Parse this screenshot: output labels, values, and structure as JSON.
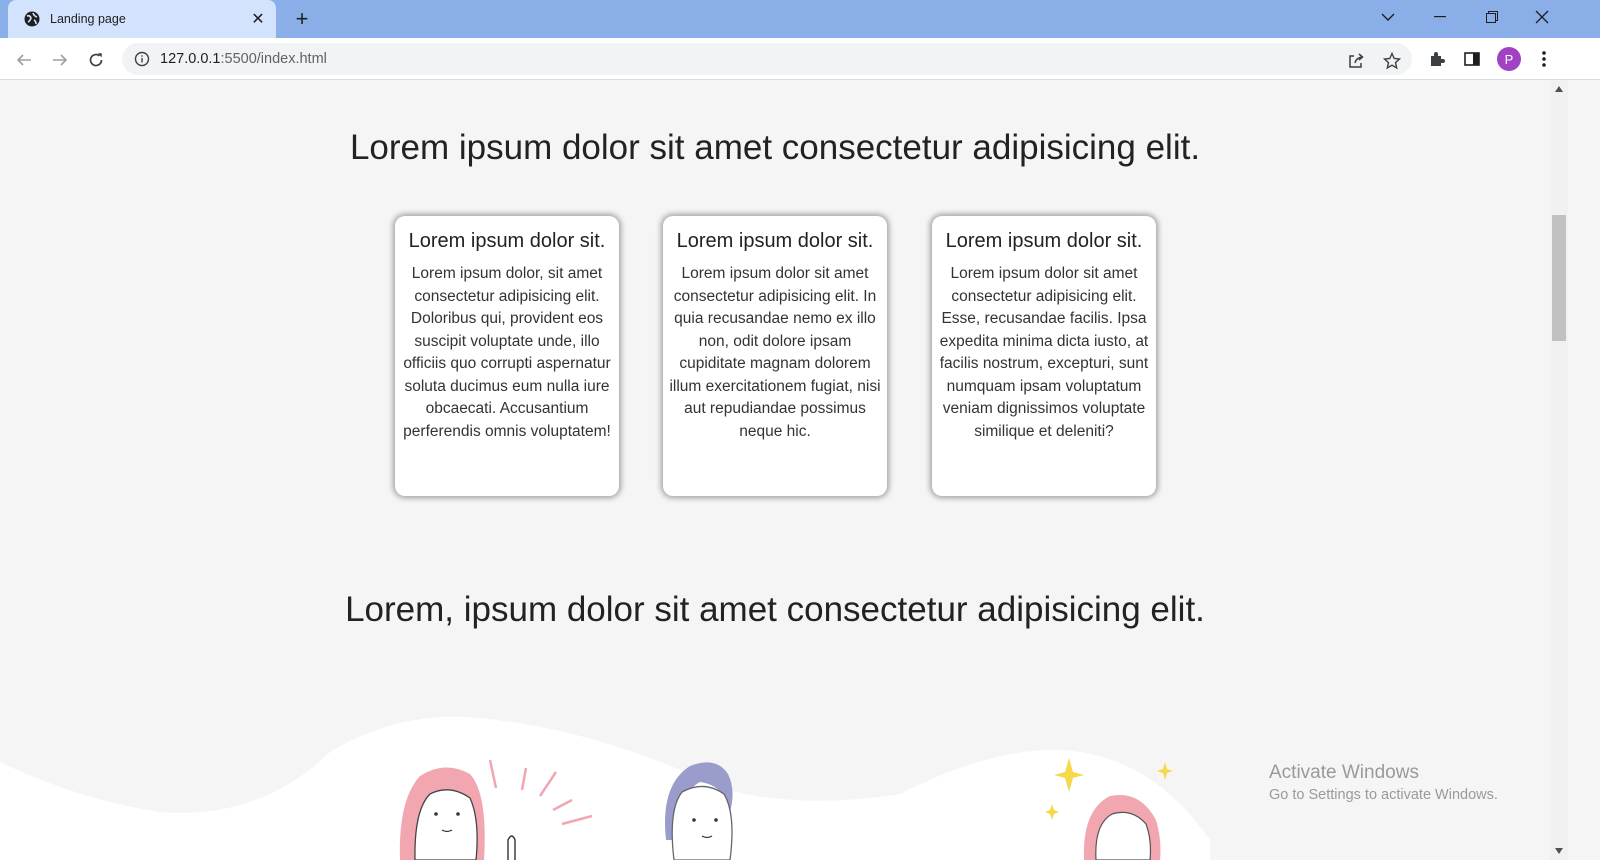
{
  "browser": {
    "tab_title": "Landing page",
    "url_host": "127.0.0.1",
    "url_path": ":5500/index.html",
    "profile_initial": "P"
  },
  "page": {
    "heading_1": "Lorem ipsum dolor sit amet consectetur adipisicing elit.",
    "cards": [
      {
        "title": "Lorem ipsum dolor sit.",
        "text": "Lorem ipsum dolor, sit amet consectetur adipisicing elit. Doloribus qui, provident eos suscipit voluptate unde, illo officiis quo corrupti aspernatur soluta ducimus eum nulla iure obcaecati. Accusantium perferendis omnis voluptatem!"
      },
      {
        "title": "Lorem ipsum dolor sit.",
        "text": "Lorem ipsum dolor sit amet consectetur adipisicing elit. In quia recusandae nemo ex illo non, odit dolore ipsam cupiditate magnam dolorem illum exercitationem fugiat, nisi aut repudiandae possimus neque hic."
      },
      {
        "title": "Lorem ipsum dolor sit.",
        "text": "Lorem ipsum dolor sit amet consectetur adipisicing elit. Esse, recusandae facilis. Ipsa expedita minima dicta iusto, at facilis nostrum, excepturi, sunt numquam ipsam voluptatum veniam dignissimos voluptate similique et deleniti?"
      }
    ],
    "heading_2": "Lorem, ipsum dolor sit amet consectetur adipisicing elit."
  },
  "watermark": {
    "line1": "Activate Windows",
    "line2": "Go to Settings to activate Windows."
  },
  "colors": {
    "tabbar": "#8aaee8",
    "active_tab": "#d3e3fd",
    "page_background": "#f5f5f5",
    "avatar": "#a142c3",
    "illustration_pink": "#f2a7b0",
    "illustration_purple": "#9a9ccc",
    "sparkle_yellow": "#f5d94a"
  },
  "icons": {
    "favicon": "globe-icon",
    "tab_close": "close-icon",
    "new_tab": "plus-icon",
    "tab_search": "chevron-down-icon",
    "minimize": "minimize-icon",
    "restore": "restore-icon",
    "close_window": "close-icon",
    "back": "arrow-left-icon",
    "forward": "arrow-right-icon",
    "reload": "reload-icon",
    "site_info": "info-icon",
    "share": "share-icon",
    "bookmark": "star-icon",
    "extensions": "puzzle-icon",
    "side_panel": "side-panel-icon",
    "menu": "kebab-menu-icon"
  }
}
